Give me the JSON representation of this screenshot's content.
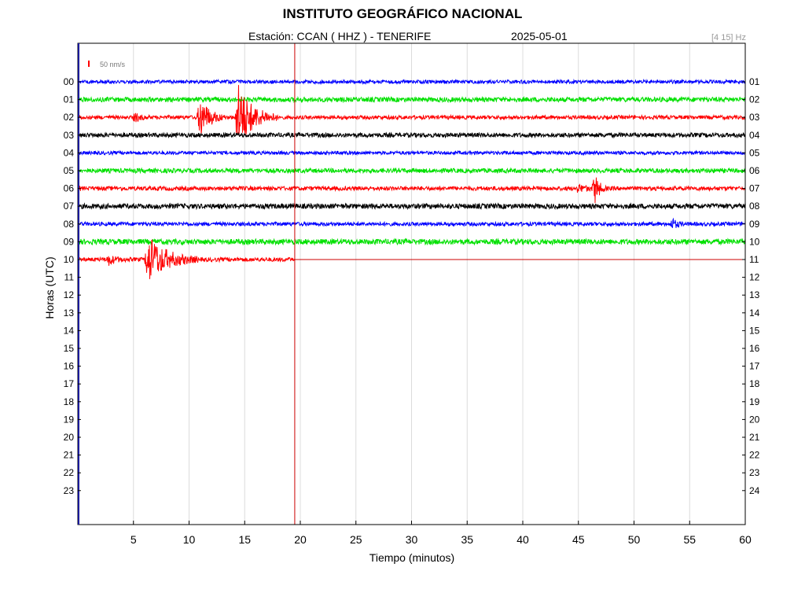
{
  "header": {
    "title": "INSTITUTO GEOGRÁFICO NACIONAL",
    "station": "Estación:  CCAN ( HHZ ) - TENERIFE",
    "date": "2025-05-01",
    "filter": "[4 15] Hz"
  },
  "chart_data": {
    "type": "line",
    "xlabel": "Tiempo (minutos)",
    "ylabel": "Horas (UTC)",
    "xlim": [
      0,
      60
    ],
    "x_ticks": [
      5,
      10,
      15,
      20,
      25,
      30,
      35,
      40,
      45,
      50,
      55,
      60
    ],
    "left_hour_labels": [
      "00",
      "01",
      "02",
      "03",
      "04",
      "05",
      "06",
      "07",
      "08",
      "09",
      "10",
      "11",
      "12",
      "13",
      "14",
      "15",
      "16",
      "17",
      "18",
      "19",
      "20",
      "21",
      "22",
      "23"
    ],
    "right_hour_labels": [
      "01",
      "02",
      "03",
      "04",
      "05",
      "06",
      "07",
      "08",
      "09",
      "10",
      "11",
      "12",
      "13",
      "14",
      "15",
      "16",
      "17",
      "18",
      "19",
      "20",
      "21",
      "22",
      "23",
      "24"
    ],
    "grid": true,
    "scale_bar": "50 nm/s",
    "current_time_marker_minute": 19.5,
    "trace_colors": [
      "#0000ff",
      "#00e000",
      "#ff0000",
      "#000000"
    ],
    "traces": [
      {
        "hour": 0,
        "end_minute": 60,
        "noise": 2.2,
        "events": []
      },
      {
        "hour": 1,
        "end_minute": 60,
        "noise": 3.0,
        "events": []
      },
      {
        "hour": 2,
        "end_minute": 60,
        "noise": 2.4,
        "events": [
          {
            "minute": 5.2,
            "amplitude": 5,
            "duration": 1.2
          },
          {
            "minute": 11.0,
            "amplitude": 26,
            "duration": 2.2
          },
          {
            "minute": 14.4,
            "amplitude": 42,
            "duration": 3.5
          }
        ]
      },
      {
        "hour": 3,
        "end_minute": 60,
        "noise": 2.8,
        "events": []
      },
      {
        "hour": 4,
        "end_minute": 60,
        "noise": 2.2,
        "events": []
      },
      {
        "hour": 5,
        "end_minute": 60,
        "noise": 2.8,
        "events": []
      },
      {
        "hour": 6,
        "end_minute": 60,
        "noise": 2.6,
        "events": [
          {
            "minute": 45.0,
            "amplitude": 4,
            "duration": 2.0
          },
          {
            "minute": 46.5,
            "amplitude": 18,
            "duration": 1.0
          }
        ]
      },
      {
        "hour": 7,
        "end_minute": 60,
        "noise": 3.2,
        "events": []
      },
      {
        "hour": 8,
        "end_minute": 60,
        "noise": 2.4,
        "events": [
          {
            "minute": 53.5,
            "amplitude": 6,
            "duration": 1.0
          }
        ]
      },
      {
        "hour": 9,
        "end_minute": 60,
        "noise": 3.4,
        "events": []
      },
      {
        "hour": 10,
        "end_minute": 19.5,
        "noise": 2.6,
        "events": [
          {
            "minute": 2.8,
            "amplitude": 6,
            "duration": 1.5
          },
          {
            "minute": 6.3,
            "amplitude": 30,
            "duration": 4.5
          }
        ]
      }
    ]
  }
}
